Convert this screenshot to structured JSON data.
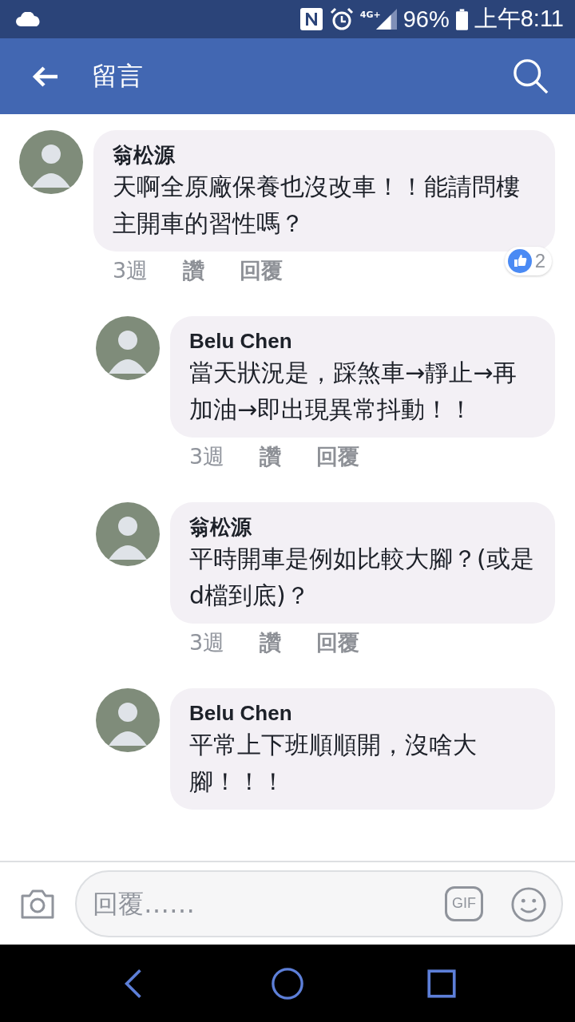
{
  "status_bar": {
    "network": "4G+",
    "battery": "96%",
    "time": "上午8:11"
  },
  "header": {
    "title": "留言"
  },
  "comments": [
    {
      "author": "翁松源",
      "text": "天啊全原廠保養也沒改車！！能請問樓主開車的習性嗎？",
      "time": "3週",
      "like": "讚",
      "reply": "回覆",
      "reactions": "2",
      "replies": [
        {
          "author": "Belu Chen",
          "text": "當天狀況是，踩煞車→靜止→再加油→即出現異常抖動！！",
          "time": "3週",
          "like": "讚",
          "reply": "回覆"
        },
        {
          "author": "翁松源",
          "text": "平時開車是例如比較大腳？(或是d檔到底)？",
          "time": "3週",
          "like": "讚",
          "reply": "回覆"
        },
        {
          "author": "Belu Chen",
          "text": "平常上下班順順開，沒啥大腳！！！"
        }
      ]
    }
  ],
  "composer": {
    "placeholder": "回覆……",
    "gif_label": "GIF"
  }
}
